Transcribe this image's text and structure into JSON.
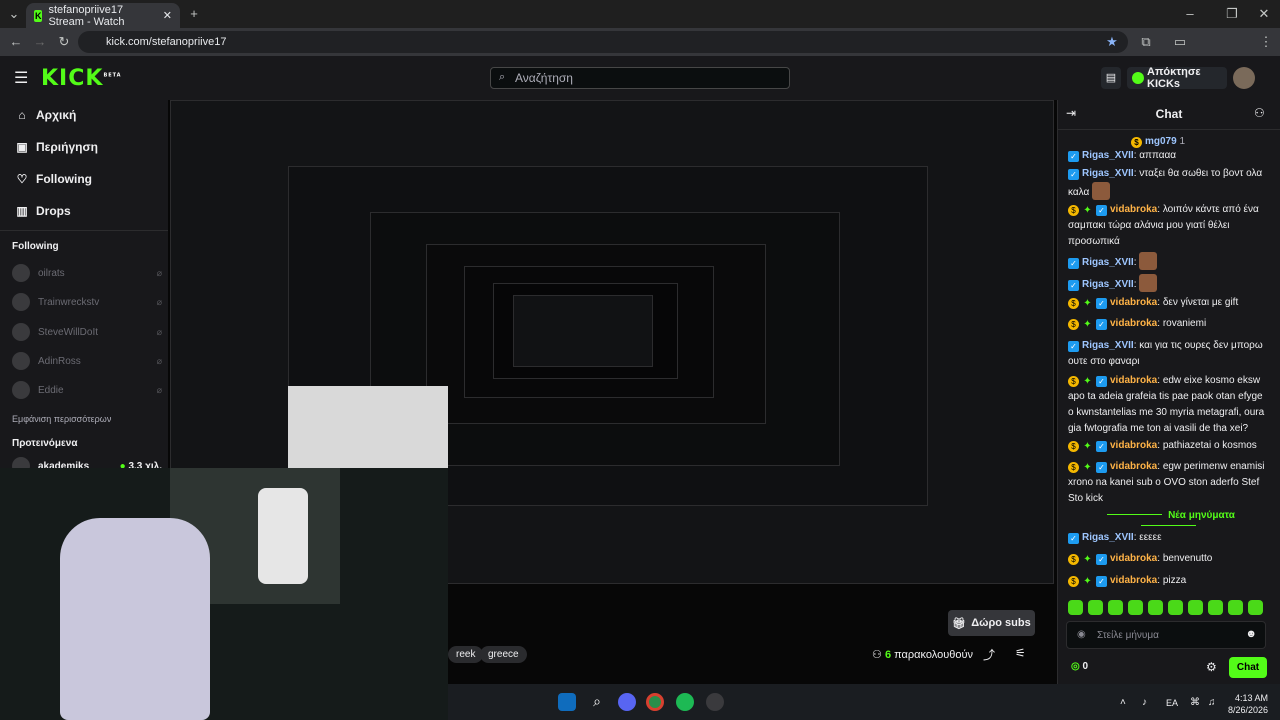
{
  "browser": {
    "tab_title": "stefanopriive17 Stream - Watch",
    "url": "kick.com/stefanopriive17"
  },
  "header": {
    "logo": "KICK",
    "logo_beta": "BETA",
    "search_placeholder": "Αναζήτηση",
    "claim_button": "Απόκτησε KICKs"
  },
  "sidebar": {
    "nav": [
      {
        "label": "Αρχική",
        "icon": "home-icon"
      },
      {
        "label": "Περιήγηση",
        "icon": "browse-icon"
      },
      {
        "label": "Following",
        "icon": "heart-icon"
      },
      {
        "label": "Drops",
        "icon": "drops-icon"
      }
    ],
    "following_title": "Following",
    "following": [
      "oilrats",
      "Trainwreckstv",
      "SteveWillDoIt",
      "AdinRoss",
      "Eddie"
    ],
    "show_more": "Εμφάνιση περισσότερων",
    "recommended_title": "Προτεινόμενα",
    "recommended": [
      {
        "name": "akademiks",
        "viewers": "3,3 χιλ."
      }
    ]
  },
  "stream": {
    "tags": [
      "reek",
      "greece"
    ],
    "gift_button": "Δώρο subs",
    "viewer_count": "6",
    "viewer_label": "παρακολουθούν"
  },
  "chat": {
    "title": "Chat",
    "pinned_user": "mg079",
    "pinned_count": "1",
    "messages": [
      {
        "user": "Rigas_XVII",
        "text": "αππααα",
        "style": "u1"
      },
      {
        "user": "Rigas_XVII",
        "text": "νταξει θα σωθει το βοντ ολα καλα",
        "style": "u1"
      },
      {
        "user": "vidabroka",
        "text": "λοιπόν κάντε από ένα σαμπακι τώρα αλάνια μου γιατί θέλει προσωπικά",
        "style": "u2"
      },
      {
        "user": "Rigas_XVII",
        "text": "",
        "style": "u1"
      },
      {
        "user": "Rigas_XVII",
        "text": "",
        "style": "u1"
      },
      {
        "user": "vidabroka",
        "text": "δεν γίνεται με gift",
        "style": "u2"
      },
      {
        "user": "vidabroka",
        "text": "rovaniemi",
        "style": "u2"
      },
      {
        "user": "Rigas_XVII",
        "text": "και για τις ουρες δεν μπορω ουτε στο φαναρι",
        "style": "u1"
      },
      {
        "user": "vidabroka",
        "text": "edw eixe kosmo eksw apo ta adeia grafeia tis pae paok otan efyge o kwnstantelias me 30 myria metagrafi, oura gia fwtografia me ton ai vasili de tha xei?",
        "style": "u2"
      },
      {
        "user": "vidabroka",
        "text": "pathiazetai o kosmos",
        "style": "u2"
      },
      {
        "user": "vidabroka",
        "text": "egw perimenw enamisi xrono na kanei sub o OVO ston aderfo Stef Sto kick",
        "style": "u2"
      }
    ],
    "new_messages_label": "Νέα μηνύματα",
    "new_messages": [
      {
        "user": "Rigas_XVII",
        "text": "εεεεε",
        "style": "u1"
      },
      {
        "user": "vidabroka",
        "text": "benvenutto",
        "style": "u2"
      },
      {
        "user": "vidabroka",
        "text": "pizza",
        "style": "u2"
      }
    ],
    "input_placeholder": "Στείλε μήνυμα",
    "kick_points": "0",
    "send_button": "Chat"
  },
  "taskbar": {
    "lang": "EA",
    "time": "4:13 AM",
    "date": "8/26/2026"
  },
  "colors": {
    "accent": "#53fc18",
    "bg": "#0b0e0f",
    "panel": "#18181b"
  }
}
